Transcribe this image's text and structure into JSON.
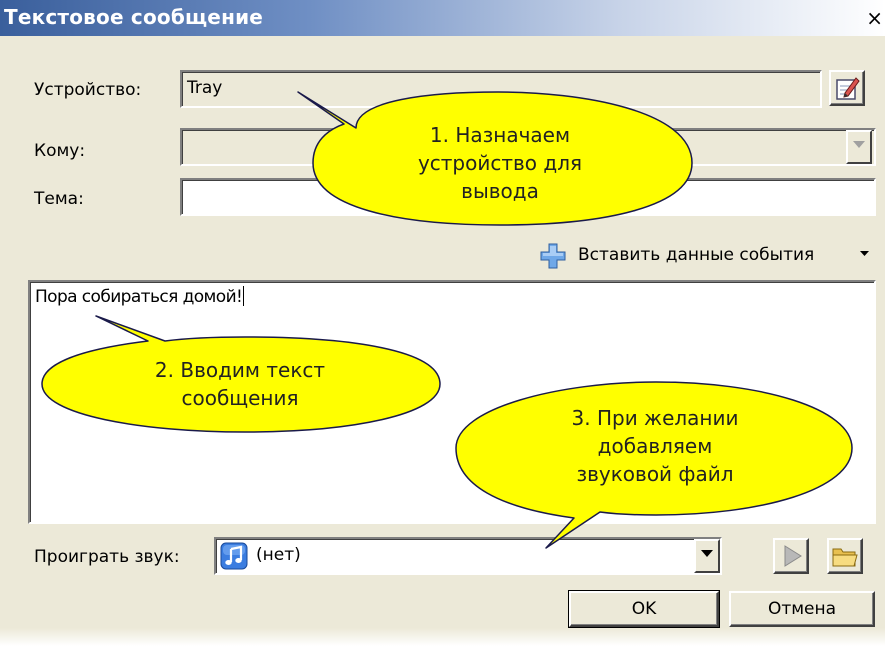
{
  "window": {
    "title": "Текстовое сообщение",
    "close_glyph": "×"
  },
  "device": {
    "label": "Устройство:",
    "value": "Tray"
  },
  "recipient": {
    "label": "Кому:",
    "value": ""
  },
  "subject": {
    "label": "Тема:",
    "value": ""
  },
  "insert_event_data": {
    "label": "Вставить данные события",
    "icon": "plus-icon"
  },
  "message": {
    "text": "Пора собираться домой!"
  },
  "sound": {
    "label": "Проиграть звук:",
    "value": "(нет)",
    "icon": "music-note-icon"
  },
  "buttons": {
    "ok": "OK",
    "cancel": "Отмена"
  },
  "callouts": [
    {
      "lines": [
        "1. Назначаем",
        "устройство для",
        "вывода"
      ]
    },
    {
      "lines": [
        "2. Вводим текст",
        "сообщения"
      ]
    },
    {
      "lines": [
        "3. При желании",
        "добавляем",
        "звуковой файл"
      ]
    }
  ],
  "colors": {
    "bubble_fill": "#ffff00",
    "bubble_stroke": "#1a1a4a",
    "dialog_bg": "#ece9d8",
    "titlebar": "#3a5f9c"
  }
}
